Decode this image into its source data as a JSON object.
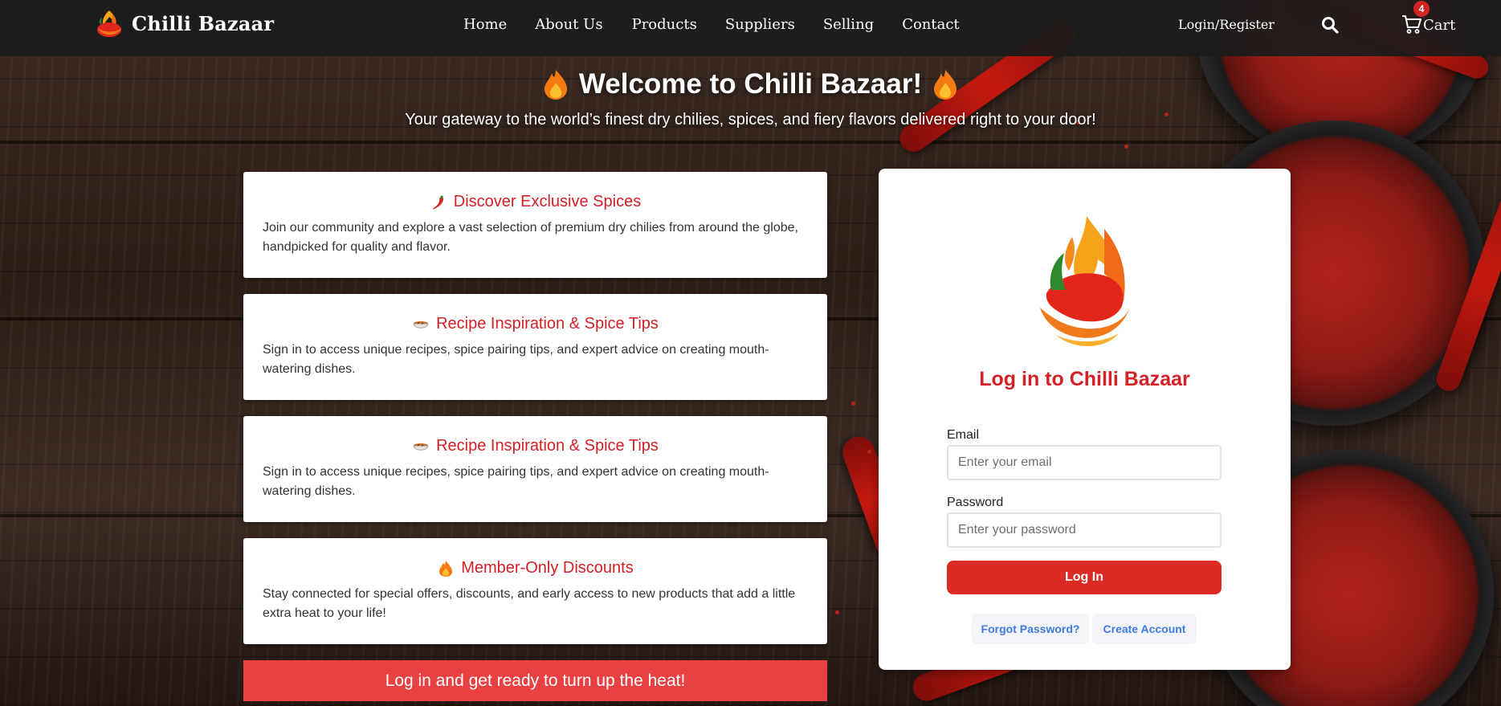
{
  "nav": {
    "brand": "Chilli Bazaar",
    "links": [
      "Home",
      "About Us",
      "Products",
      "Suppliers",
      "Selling",
      "Contact"
    ],
    "login_register": "Login/Register",
    "cart_label": "Cart",
    "cart_count": "4",
    "icons": {
      "search": "search-icon",
      "cart": "cart-icon",
      "logo": "chili-flame-logo"
    }
  },
  "hero": {
    "title": "Welcome to Chilli Bazaar!",
    "subtitle": "Your gateway to the world’s finest dry chilies, spices, and fiery flavors delivered right to your door!"
  },
  "features": [
    {
      "icon": "chili-pepper-icon",
      "title": "Discover Exclusive Spices",
      "text": "Join our community and explore a vast selection of premium dry chilies from around the globe, handpicked for quality and flavor."
    },
    {
      "icon": "curry-bowl-icon",
      "title": "Recipe Inspiration & Spice Tips",
      "text": "Sign in to access unique recipes, spice pairing tips, and expert advice on creating mouth-watering dishes."
    },
    {
      "icon": "curry-bowl-icon",
      "title": "Recipe Inspiration & Spice Tips",
      "text": "Sign in to access unique recipes, spice pairing tips, and expert advice on creating mouth-watering dishes."
    },
    {
      "icon": "flame-icon",
      "title": "Member-Only Discounts",
      "text": "Stay connected for special offers, discounts, and early access to new products that add a little extra heat to your life!"
    }
  ],
  "cta": "Log in and get ready to turn up the heat!",
  "login": {
    "title": "Log in to Chilli Bazaar",
    "email_label": "Email",
    "email_placeholder": "Enter your email",
    "password_label": "Password",
    "password_placeholder": "Enter your password",
    "submit": "Log In",
    "forgot": "Forgot Password?",
    "create": "Create Account"
  },
  "colors": {
    "accent": "#d42027",
    "button": "#dc2a25",
    "cta": "#e94141",
    "link": "#3f7be0",
    "navbar": "#1c1c1c"
  }
}
